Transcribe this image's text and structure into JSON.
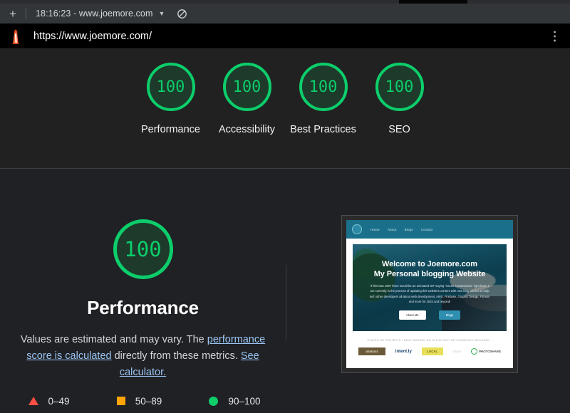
{
  "window": {
    "tab": {
      "new_tab_label": "+",
      "title": "18:16:23 - www.joemore.com",
      "caret_icon": "chevron-down-icon",
      "block_icon": "block-icon"
    },
    "urlbar": {
      "favicon": "lighthouse-icon",
      "url": "https://www.joemore.com/",
      "menu_icon": "kebab-menu-icon"
    }
  },
  "summary": {
    "categories": [
      {
        "score": "100",
        "label": "Performance"
      },
      {
        "score": "100",
        "label": "Accessibility"
      },
      {
        "score": "100",
        "label": "Best Practices"
      },
      {
        "score": "100",
        "label": "SEO"
      }
    ]
  },
  "performance": {
    "score": "100",
    "title": "Performance",
    "description": {
      "part1": "Values are estimated and may vary. The ",
      "link1": "performance score is calculated",
      "part2": " directly from these metrics. ",
      "link2": "See calculator."
    },
    "legend": [
      {
        "icon": "triangle-icon",
        "range": "0–49",
        "color": "#ff4e42"
      },
      {
        "icon": "square-icon",
        "range": "50–89",
        "color": "#ffa400"
      },
      {
        "icon": "circle-icon",
        "range": "90–100",
        "color": "#0cce6b"
      }
    ]
  },
  "thumbnail": {
    "nav": [
      "Home",
      "About",
      "Blogs",
      "Contact"
    ],
    "heading_line1": "Welcome to Joemore.com",
    "heading_line2": "My Personal blogging Website",
    "paragraph": "If this was 1997 there would be an animated GIF saying \"Under Construction\" right here. I am currently in the process of updating this websites content with new blog articles to help tech other developers all about web development, AWS, Firebase, Graphic Design, Fitness and more for 2022 and beyond!",
    "buttons": [
      "About Me",
      "Blogs"
    ],
    "footer_caption": "PLACES OR PROJECTS I HAVE WORKED ON IN THE PAST OR CURRENTLY BUILDING...",
    "logos": [
      "abstract",
      "intent.ly",
      "LOCAL",
      "studio",
      "PHOTOSHARE"
    ]
  },
  "colors": {
    "pass": "#0cce6b",
    "average": "#ffa400",
    "fail": "#ff4e42",
    "link": "#9ac5f4",
    "background": "#202124"
  }
}
